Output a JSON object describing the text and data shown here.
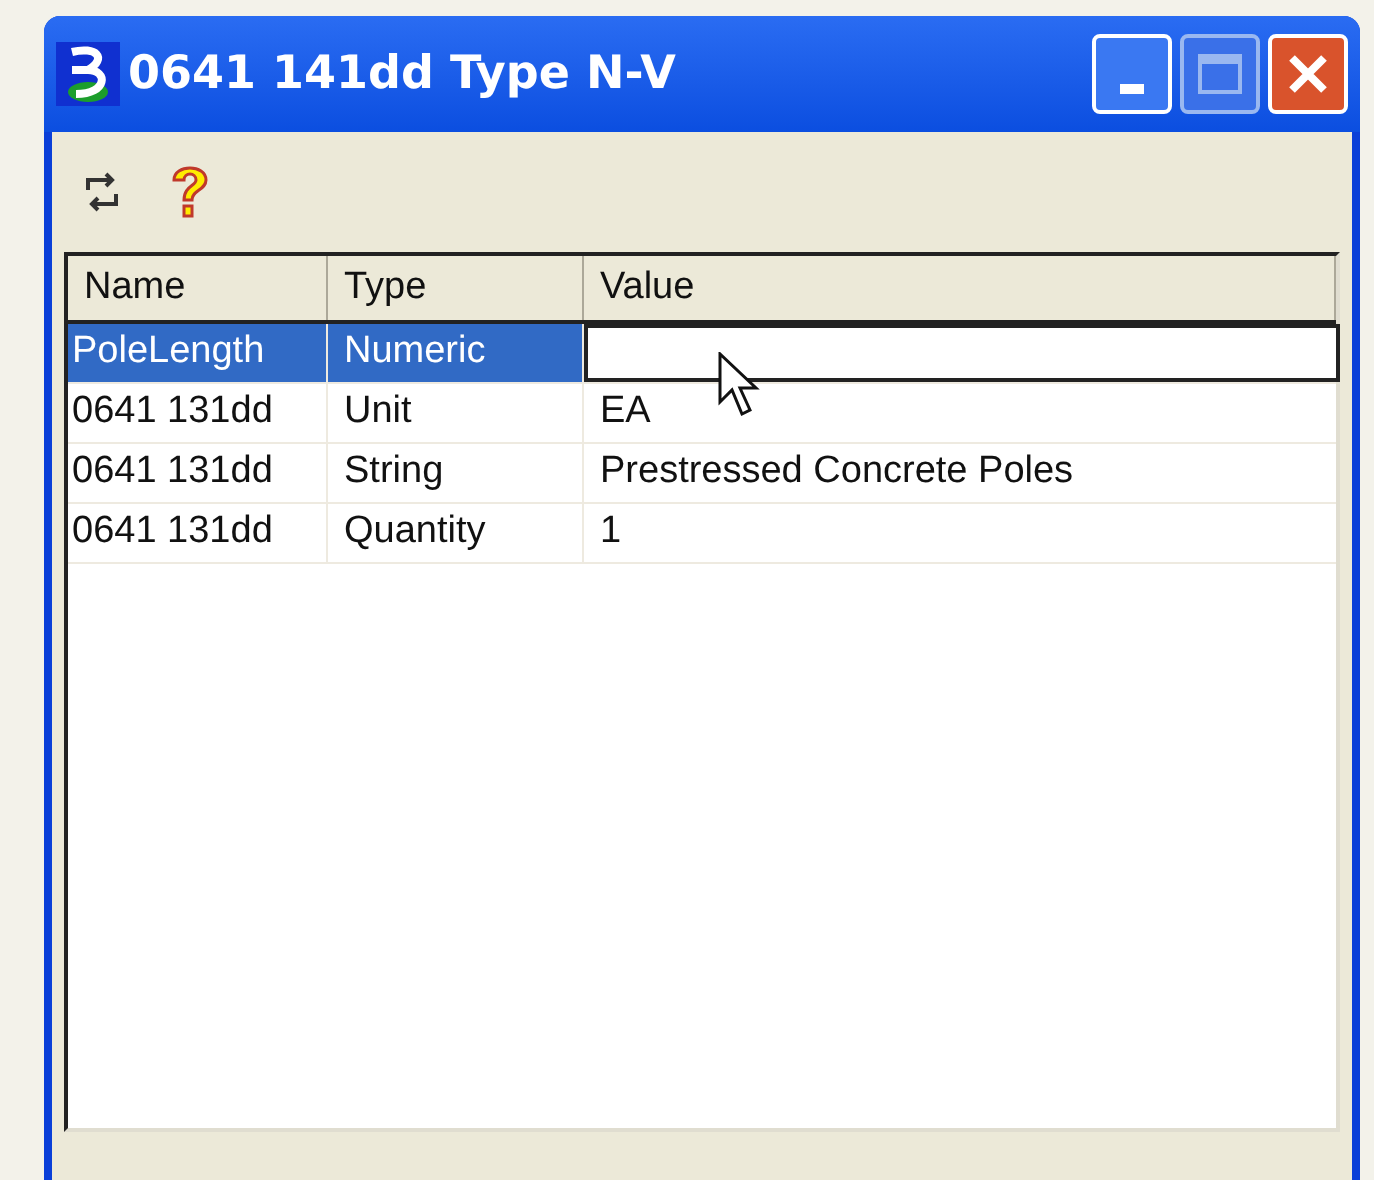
{
  "window": {
    "title": "0641 141dd Type N-V"
  },
  "table": {
    "columns": [
      "Name",
      "Type",
      "Value"
    ],
    "rows": [
      {
        "name": "PoleLength",
        "type": "Numeric",
        "selected": true
      },
      {
        "name": "0641 131dd",
        "type": "Unit",
        "value": "EA",
        "selected": false
      },
      {
        "name": "0641 131dd",
        "type": "String",
        "value": "Prestressed Concrete Poles",
        "selected": false
      },
      {
        "name": "0641 131dd",
        "type": "Quantity",
        "value": "1",
        "selected": false
      }
    ]
  }
}
